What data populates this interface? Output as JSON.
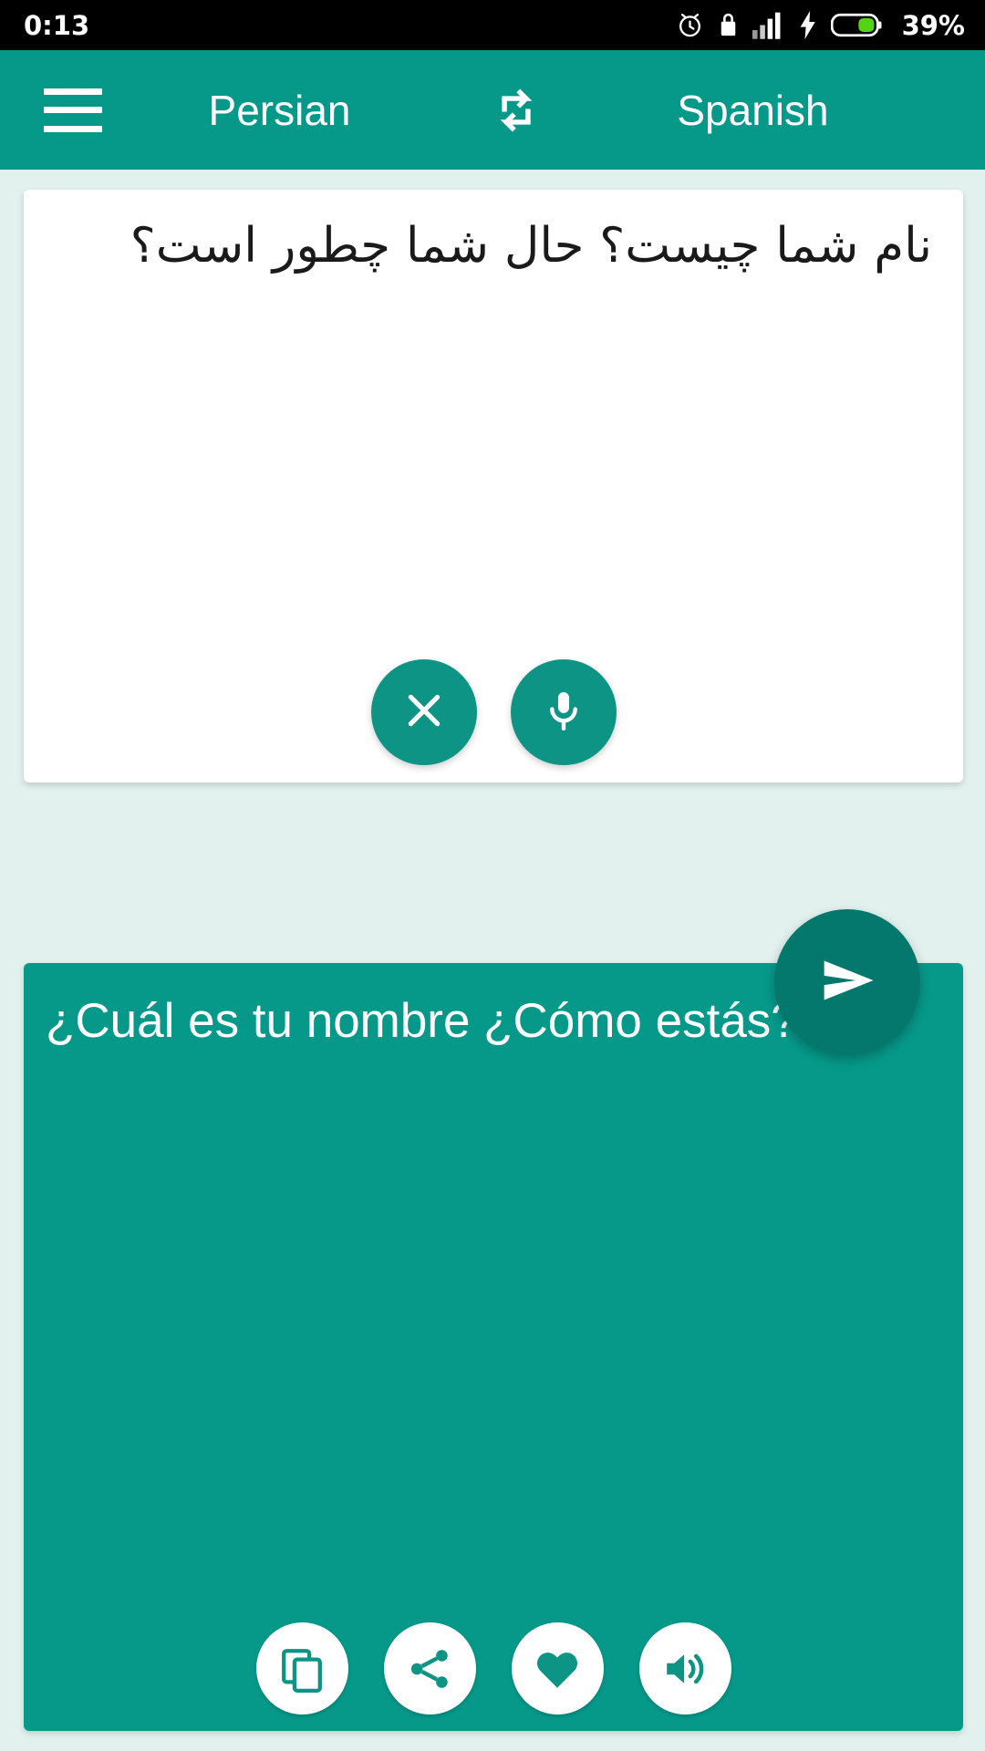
{
  "status_bar": {
    "time": "0:13",
    "battery_percent": "39%",
    "icons": [
      "alarm-icon",
      "lock-icon",
      "signal-bars-icon",
      "charging-bolt-icon",
      "battery-icon"
    ]
  },
  "toolbar": {
    "menu_icon": "hamburger-menu-icon",
    "source_language": "Persian",
    "swap_icon": "swap-languages-icon",
    "target_language": "Spanish",
    "background_color": "#06998a"
  },
  "source_panel": {
    "text": "نام شما چیست؟ حال شما چطور است؟",
    "background_color": "#ffffff",
    "text_color": "#1a1a1a",
    "actions": [
      {
        "name": "clear-button",
        "icon": "close-x-icon"
      },
      {
        "name": "microphone-button",
        "icon": "microphone-icon"
      }
    ]
  },
  "send_button": {
    "icon": "send-arrow-icon",
    "color": "#04786d"
  },
  "target_panel": {
    "text": "¿Cuál es tu nombre ¿Cómo estás?",
    "background_color": "#06998a",
    "text_color": "#ffffff",
    "actions": [
      {
        "name": "copy-button",
        "icon": "copy-icon"
      },
      {
        "name": "share-button",
        "icon": "share-icon"
      },
      {
        "name": "favorite-button",
        "icon": "heart-icon"
      },
      {
        "name": "speak-button",
        "icon": "speaker-icon"
      }
    ]
  },
  "page_background": "#e2f1ee"
}
